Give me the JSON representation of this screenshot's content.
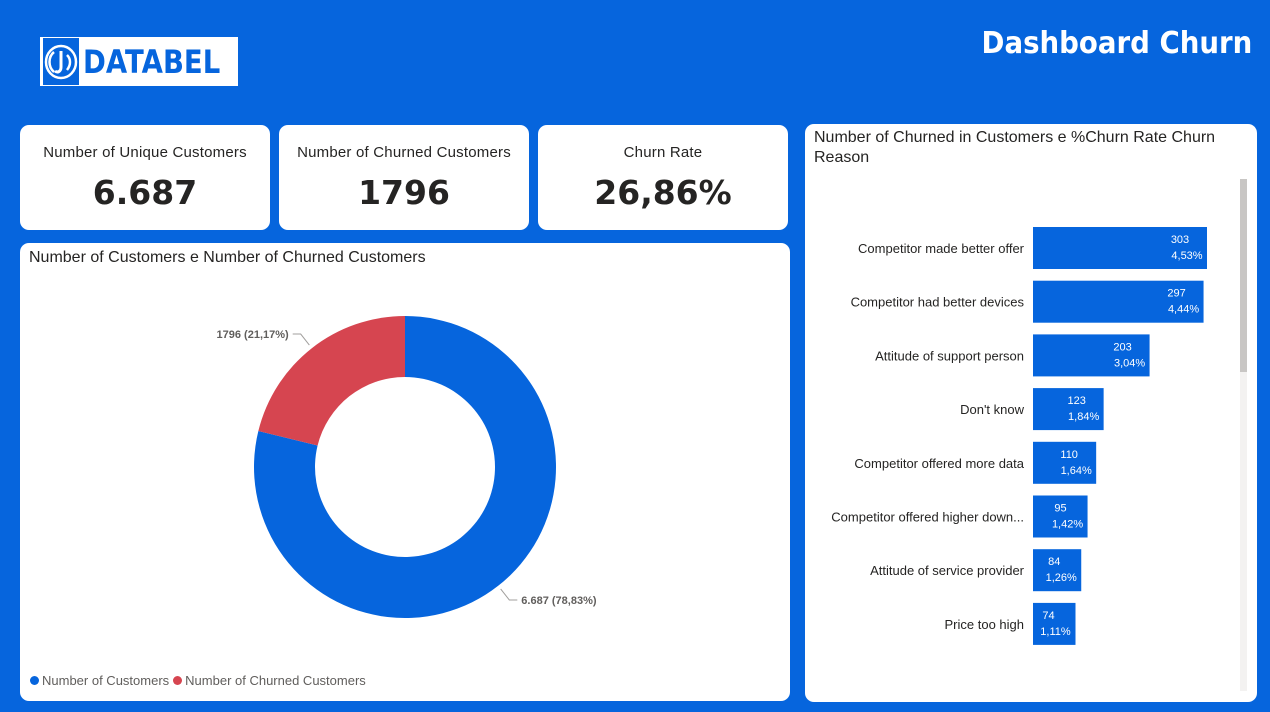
{
  "header": {
    "logo_text": "DATABEL",
    "title": "Dashboard Churn"
  },
  "kpis": [
    {
      "label": "Number of Unique Customers",
      "value": "6.687"
    },
    {
      "label": "Number of Churned Customers",
      "value": "1796"
    },
    {
      "label": "Churn Rate",
      "value": "26,86%"
    }
  ],
  "colors": {
    "background": "#0665dd",
    "customers": "#0665dd",
    "churned": "#d64550",
    "card": "#ffffff"
  },
  "chart_data": [
    {
      "type": "pie",
      "variant": "donut",
      "title": "Number of Customers e Number of Churned Customers",
      "series": [
        {
          "name": "Number of Customers",
          "value": 6687,
          "label": "6.687 (78,83%)",
          "color": "#0665dd"
        },
        {
          "name": "Number of Churned Customers",
          "value": 1796,
          "label": "1796 (21,17%)",
          "color": "#d64550"
        }
      ],
      "legend": "bottom-left"
    },
    {
      "type": "bar",
      "orientation": "horizontal",
      "title": "Number of Churned in Customers e %Churn Rate Churn Reason",
      "categories": [
        "Competitor made better offer",
        "Competitor had better devices",
        "Attitude of support person",
        "Don't know",
        "Competitor offered more data",
        "Competitor offered higher down...",
        "Attitude of service provider",
        "Price too high"
      ],
      "values": [
        303,
        297,
        203,
        123,
        110,
        95,
        84,
        74
      ],
      "pct_labels": [
        "4,53%",
        "4,44%",
        "3,04%",
        "1,84%",
        "1,64%",
        "1,42%",
        "1,26%",
        "1,11%"
      ],
      "color": "#0665dd"
    }
  ]
}
